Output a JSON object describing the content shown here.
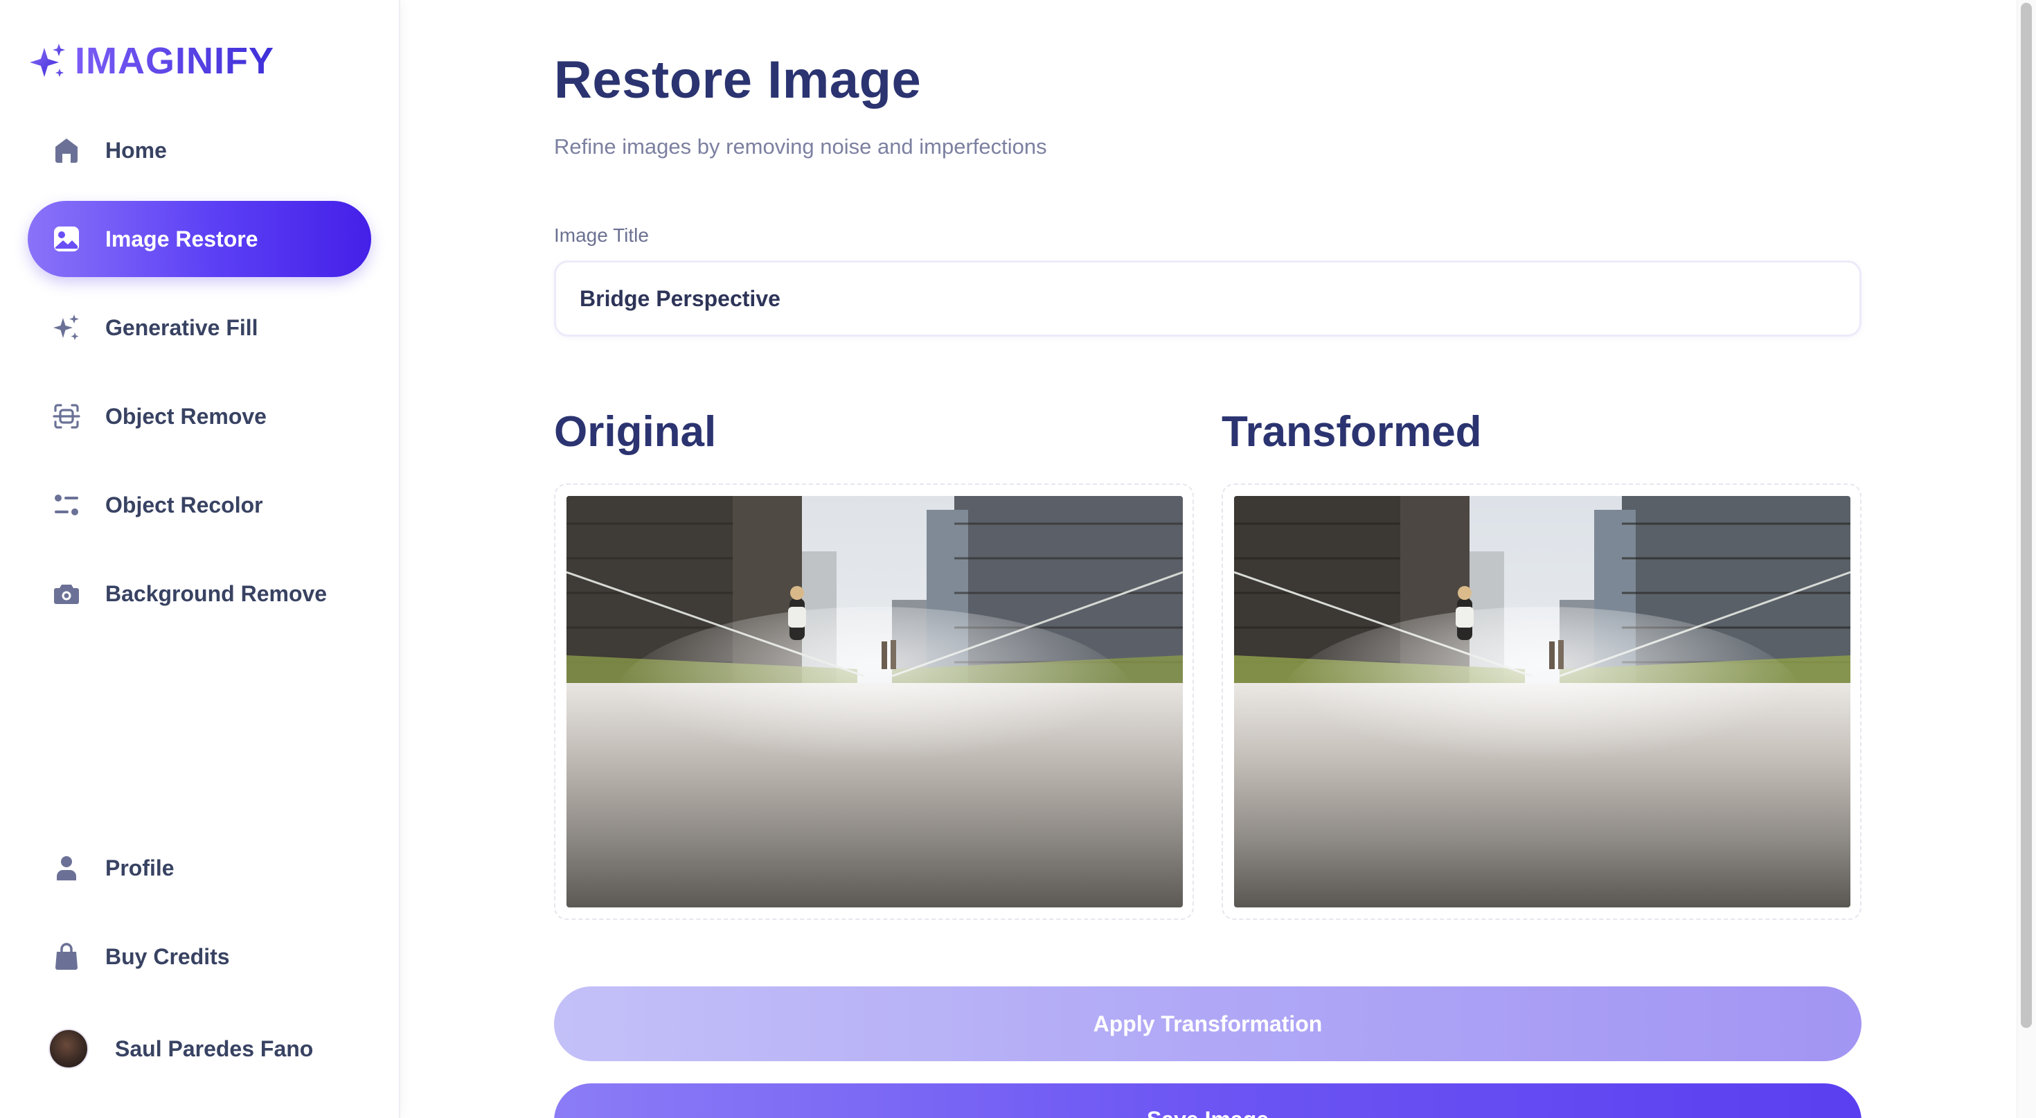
{
  "app": {
    "brand": "IMAGINIFY"
  },
  "sidebar": {
    "items": [
      {
        "label": "Home",
        "icon": "home-icon"
      },
      {
        "label": "Image Restore",
        "icon": "image-icon",
        "active": true
      },
      {
        "label": "Generative Fill",
        "icon": "sparkles-icon"
      },
      {
        "label": "Object Remove",
        "icon": "scan-icon"
      },
      {
        "label": "Object Recolor",
        "icon": "filter-icon"
      },
      {
        "label": "Background Remove",
        "icon": "camera-icon"
      }
    ],
    "bottom_items": [
      {
        "label": "Profile",
        "icon": "user-icon"
      },
      {
        "label": "Buy Credits",
        "icon": "bag-icon"
      }
    ],
    "user": {
      "name": "Saul Paredes Fano"
    }
  },
  "main": {
    "title": "Restore Image",
    "subtitle": "Refine images by removing noise and imperfections",
    "image_title_label": "Image Title",
    "image_title_value": "Bridge Perspective",
    "original_label": "Original",
    "transformed_label": "Transformed",
    "apply_button": "Apply Transformation",
    "save_button": "Save Image"
  },
  "colors": {
    "accent": "#5b3ff5",
    "heading": "#2b3470",
    "apply_button_disabled": "#b0a8f6"
  }
}
